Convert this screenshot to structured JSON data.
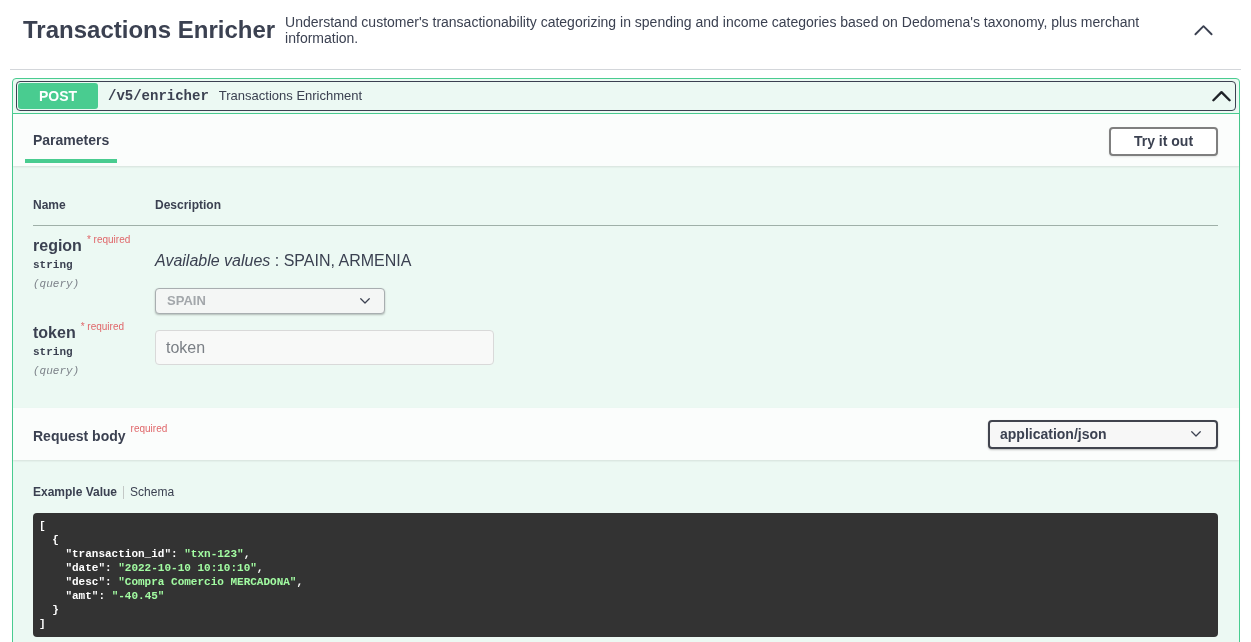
{
  "section": {
    "title": "Transactions Enricher",
    "description": "Understand customer's transactionability categorizing in spending and income categories based on Dedomena's taxonomy, plus merchant information.",
    "expanded": true
  },
  "operation": {
    "method": "POST",
    "path": "/v5/enricher",
    "summary": "Transactions Enrichment",
    "expanded": true,
    "tabs": [
      {
        "label": "Parameters",
        "selected": true
      }
    ],
    "try_button": "Try it out",
    "parameters": {
      "columns": [
        "Name",
        "Description"
      ],
      "rows": [
        {
          "kind": "select",
          "name": "region",
          "required": "* required",
          "type": "string",
          "location": "(query)",
          "description": "*Available values* : SPAIN, ARMENIA",
          "value": "SPAIN",
          "disabled": true
        },
        {
          "kind": "input",
          "name": "token",
          "required": "* required",
          "type": "string",
          "location": "(query)",
          "placeholder": "token"
        }
      ]
    },
    "request_body": {
      "title": "Request body",
      "required": "required",
      "content_type": "application/json",
      "example_tabs": [
        {
          "label": "Example Value",
          "selected": true
        },
        {
          "label": "Schema",
          "selected": false
        }
      ],
      "code_lines": [
        [
          {
            "kind": "plain",
            "text": "["
          }
        ],
        [
          {
            "kind": "plain",
            "text": "  {"
          }
        ],
        [
          {
            "kind": "plain",
            "text": "    \"transaction_id\": "
          },
          {
            "kind": "string",
            "text": "\"txn-123\""
          },
          {
            "kind": "plain",
            "text": ","
          }
        ],
        [
          {
            "kind": "plain",
            "text": "    \"date\": "
          },
          {
            "kind": "string",
            "text": "\"2022-10-10 10:10:10\""
          },
          {
            "kind": "plain",
            "text": ","
          }
        ],
        [
          {
            "kind": "plain",
            "text": "    \"desc\": "
          },
          {
            "kind": "string",
            "text": "\"Compra Comercio MERCADONA\""
          },
          {
            "kind": "plain",
            "text": ","
          }
        ],
        [
          {
            "kind": "plain",
            "text": "    \"amt\": "
          },
          {
            "kind": "string",
            "text": "\"-40.45\""
          }
        ],
        [
          {
            "kind": "plain",
            "text": "  }"
          }
        ],
        [
          {
            "kind": "plain",
            "text": "]"
          }
        ]
      ]
    }
  }
}
